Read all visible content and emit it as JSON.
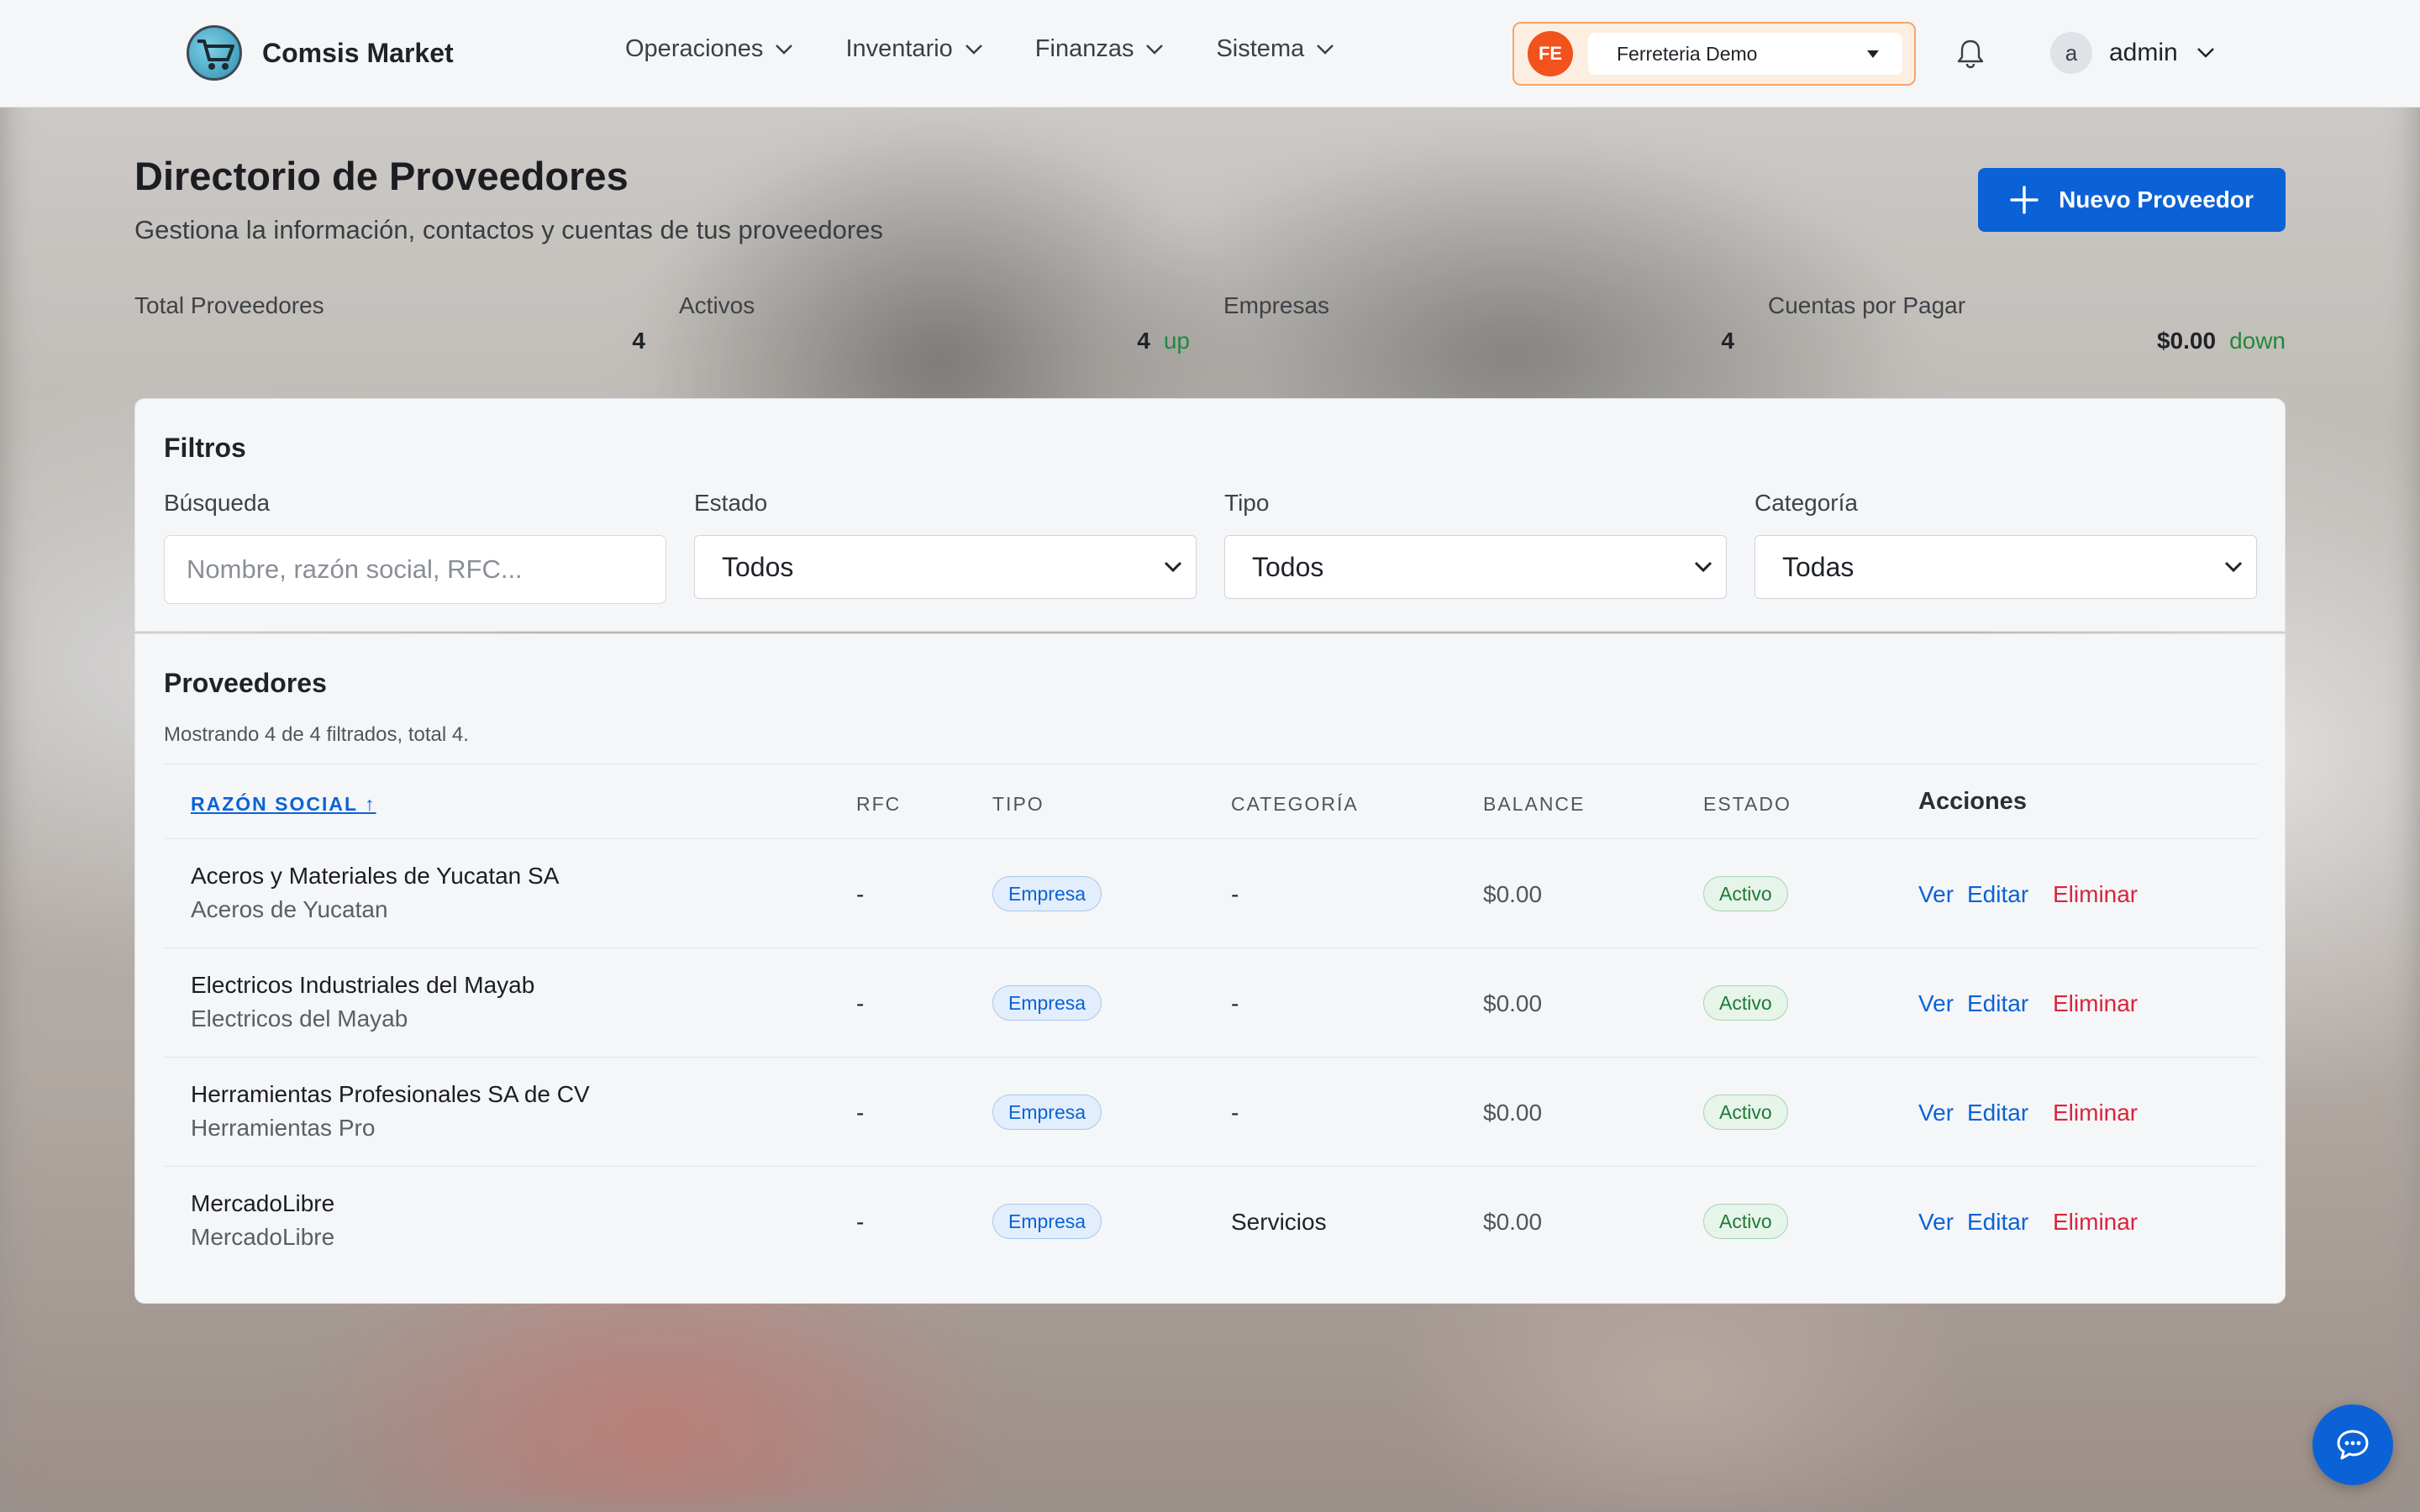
{
  "app": {
    "name": "Comsis Market"
  },
  "nav": {
    "items": [
      {
        "label": "Operaciones"
      },
      {
        "label": "Inventario"
      },
      {
        "label": "Finanzas"
      },
      {
        "label": "Sistema"
      }
    ]
  },
  "store": {
    "initials": "FE",
    "selected": "Ferreteria Demo"
  },
  "user": {
    "initial": "a",
    "name": "admin"
  },
  "page": {
    "title": "Directorio de Proveedores",
    "subtitle": "Gestiona la información, contactos y cuentas de tus proveedores",
    "new_button": "Nuevo Proveedor"
  },
  "stats": [
    {
      "label": "Total Proveedores",
      "value": "4",
      "trend": ""
    },
    {
      "label": "Activos",
      "value": "4",
      "trend": "up"
    },
    {
      "label": "Empresas",
      "value": "4",
      "trend": ""
    },
    {
      "label": "Cuentas por Pagar",
      "value": "$0.00",
      "trend": "down"
    }
  ],
  "filters": {
    "title": "Filtros",
    "search_label": "Búsqueda",
    "search_placeholder": "Nombre, razón social, RFC...",
    "estado_label": "Estado",
    "estado_value": "Todos",
    "tipo_label": "Tipo",
    "tipo_value": "Todos",
    "categoria_label": "Categoría",
    "categoria_value": "Todas"
  },
  "list": {
    "title": "Proveedores",
    "showing": "Mostrando 4 de 4 filtrados, total 4.",
    "columns": {
      "razon": "RAZÓN SOCIAL ↑",
      "rfc": "RFC",
      "tipo": "TIPO",
      "categoria": "CATEGORÍA",
      "balance": "BALANCE",
      "estado": "ESTADO",
      "acciones": "Acciones"
    },
    "actions": {
      "ver": "Ver",
      "editar": "Editar",
      "eliminar": "Eliminar"
    },
    "rows": [
      {
        "razon": "Aceros y Materiales de Yucatan SA",
        "nombre": "Aceros de Yucatan",
        "rfc": "-",
        "tipo": "Empresa",
        "categoria": "-",
        "balance": "$0.00",
        "estado": "Activo"
      },
      {
        "razon": "Electricos Industriales del Mayab",
        "nombre": "Electricos del Mayab",
        "rfc": "-",
        "tipo": "Empresa",
        "categoria": "-",
        "balance": "$0.00",
        "estado": "Activo"
      },
      {
        "razon": "Herramientas Profesionales SA de CV",
        "nombre": "Herramientas Pro",
        "rfc": "-",
        "tipo": "Empresa",
        "categoria": "-",
        "balance": "$0.00",
        "estado": "Activo"
      },
      {
        "razon": "MercadoLibre",
        "nombre": "MercadoLibre",
        "rfc": "-",
        "tipo": "Empresa",
        "categoria": "Servicios",
        "balance": "$0.00",
        "estado": "Activo"
      }
    ]
  },
  "colors": {
    "accent": "#0b62d6",
    "store_avatar": "#f2521b",
    "danger": "#d7263d",
    "success": "#1f7a36"
  },
  "icons": [
    "cart-logo-icon",
    "chevron-down-icon",
    "caret-down-icon",
    "bell-icon",
    "plus-icon",
    "chat-icon"
  ]
}
